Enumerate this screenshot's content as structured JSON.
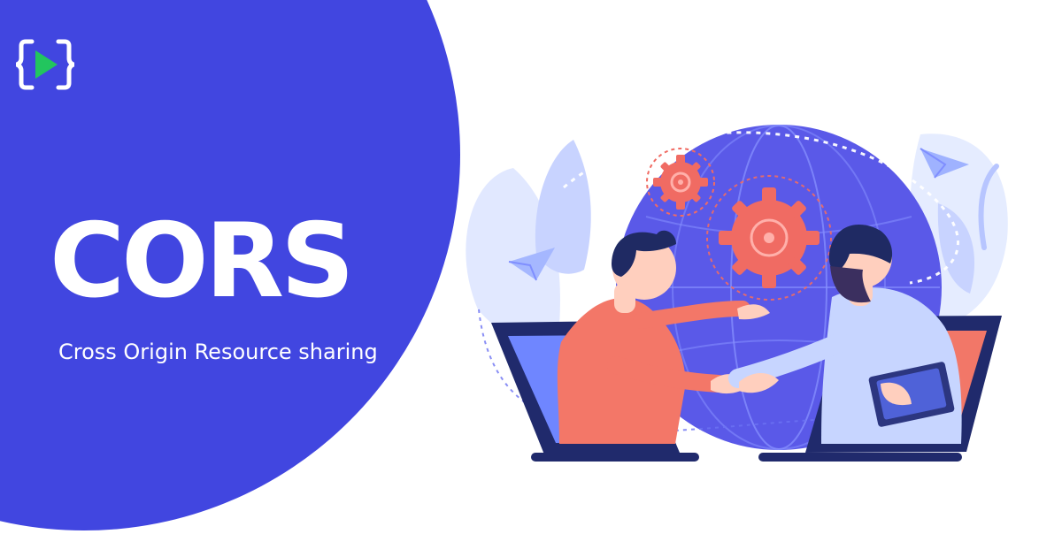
{
  "brand": {
    "logo_icon": "code-play-icon",
    "accent_color": "#4146e0",
    "logo_green": "#22c55e"
  },
  "hero": {
    "title": "CORS",
    "subtitle": "Cross Origin Resource sharing"
  },
  "illustration": {
    "name": "globe-handshake-illustration",
    "colors": {
      "globe": "#5a59e8",
      "gear": "#f06b63",
      "leaf": "#b9c7ff",
      "coral": "#f37768"
    }
  }
}
